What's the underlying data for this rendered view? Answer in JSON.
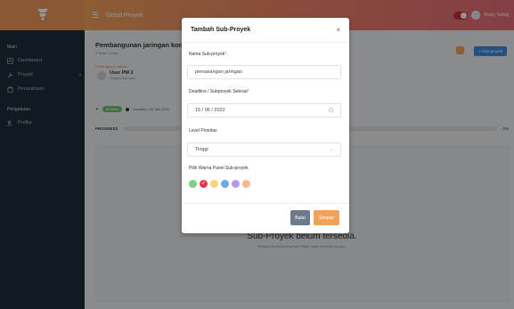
{
  "topbar": {
    "title": "Detail Proyek",
    "user_name": "Rusty Setiaji"
  },
  "sidebar": {
    "section_main": "Main",
    "items": [
      {
        "label": "Dashboard"
      },
      {
        "label": "Proyek"
      },
      {
        "label": "Perusahaan"
      }
    ],
    "section_settings": "Pengaturan",
    "settings_items": [
      {
        "label": "Profile"
      }
    ]
  },
  "project": {
    "title": "Pembangunan jaringan komputer",
    "subtitle": "2 Bulan 0 Hari",
    "pm_label": "Penanggung Jawab",
    "pm_name": "User PM 3",
    "pm_role": "Project Manager",
    "status_badge": "Berjalan",
    "deadline": "Deadline: 08 Juni 2022"
  },
  "progress": {
    "label": "PROGRESS",
    "percent": "0%"
  },
  "actions": {
    "add_subproject": "+ Sub-proyek"
  },
  "empty_state": {
    "title": "Sub-Proyek belum tersedia.",
    "desc": "Silahkan klik tombol Buat Sub-Proyek, untuk membuat sub-baru."
  },
  "modal": {
    "title": "Tambah Sub-Proyek",
    "close": "×",
    "name_label": "Nama Sub-proyek",
    "name_value": "pemasangan jaringan",
    "deadline_label": "Deadline / Subproyek Selesai",
    "deadline_value": "15 / 06 / 2022",
    "priority_label": "Level Prioritas",
    "priority_value": "Tinggi",
    "color_label": "Pilih Warna Panel Sub-proyek",
    "colors": [
      "#7ccf86",
      "#e2384f",
      "#f4d679",
      "#6aa8ef",
      "#b79af0",
      "#f4b98a"
    ],
    "cancel": "Batal",
    "save": "Simpan",
    "required_mark": "*"
  }
}
